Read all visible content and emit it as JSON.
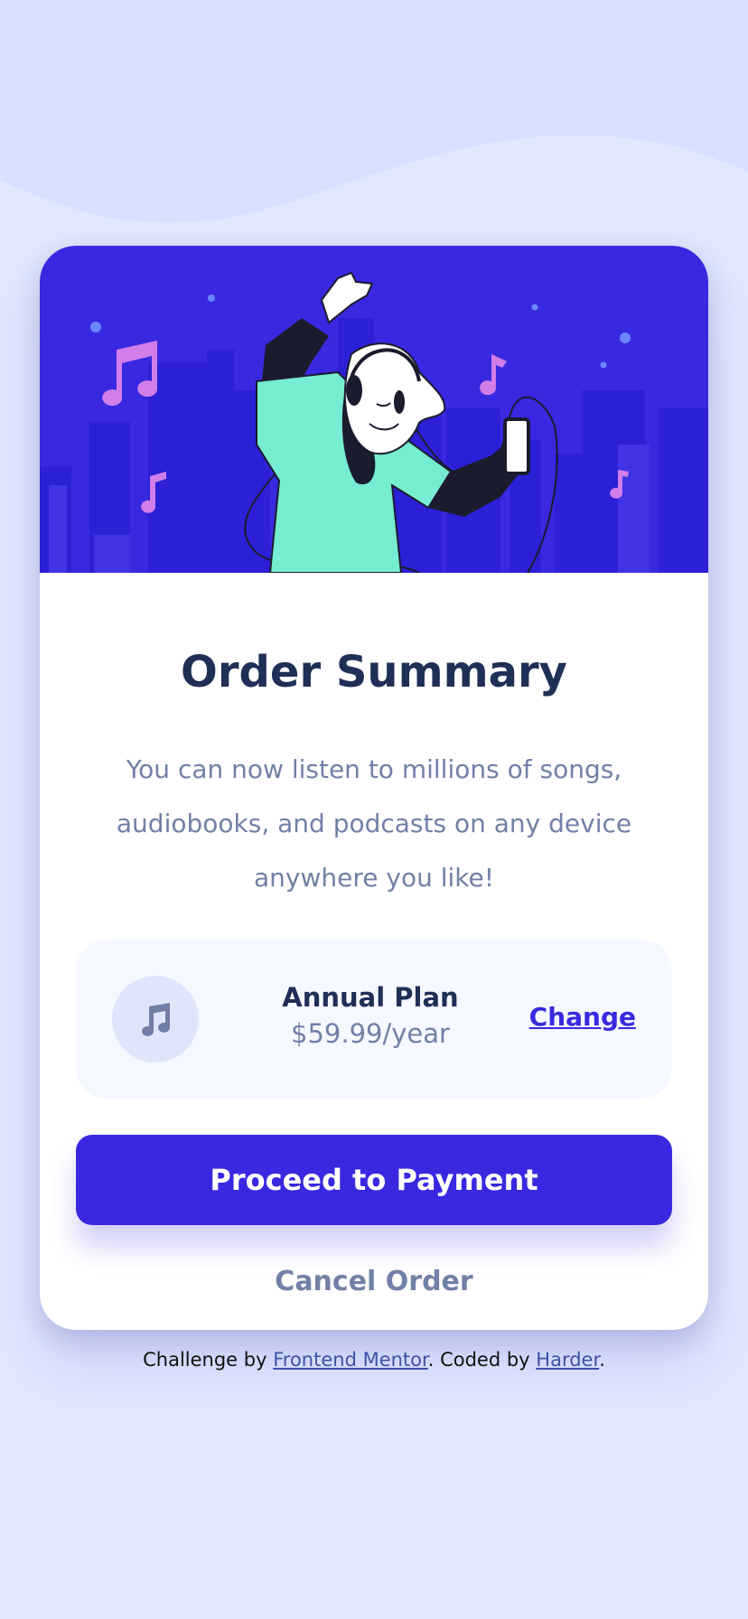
{
  "hero": {
    "illustration": "person-dancing-with-headphones-illustration",
    "colors": {
      "background": "#3829e0",
      "buildings": "#2a1fd4",
      "shirt": "#76ecd0",
      "notes": "#d17ee8"
    }
  },
  "card": {
    "title": "Order Summary",
    "description": "You can now listen to millions of songs, audiobooks, and podcasts on any device anywhere you like!"
  },
  "plan": {
    "icon": "music-note-icon",
    "name": "Annual Plan",
    "price": "$59.99/year",
    "change_label": "Change"
  },
  "actions": {
    "proceed_label": "Proceed to Payment",
    "cancel_label": "Cancel Order"
  },
  "attribution": {
    "prefix": "Challenge by",
    "link1": "Frontend Mentor",
    "middle": ". Coded by",
    "link2": "Harder",
    "suffix": "."
  },
  "colors": {
    "page_bg": "#e0e8fe",
    "wave": "#d6e1ff",
    "accent": "#3829e0",
    "heading": "#1f2f56",
    "muted": "#7180a6"
  }
}
